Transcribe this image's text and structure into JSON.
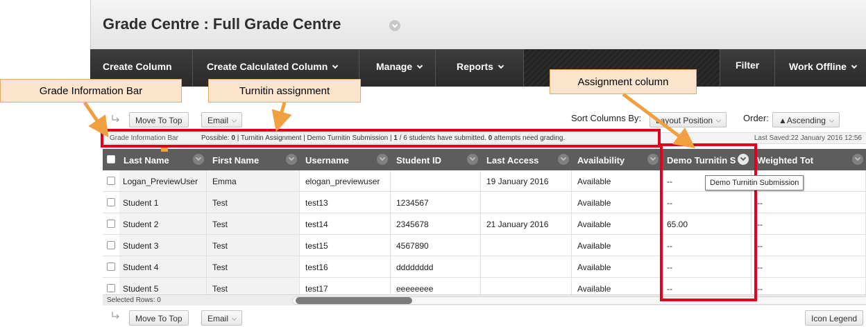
{
  "header": {
    "title": "Grade Centre : Full Grade Centre"
  },
  "toolbar": {
    "create_column": "Create Column",
    "create_calculated": "Create Calculated Column",
    "manage": "Manage",
    "reports": "Reports",
    "filter": "Filter",
    "work_offline": "Work Offline"
  },
  "callouts": {
    "grade_info_bar": "Grade Information Bar",
    "turnitin_assignment": "Turnitin assignment",
    "assignment_column": "Assignment column"
  },
  "actions": {
    "move_to_top": "Move To Top",
    "email": "Email",
    "sort_label": "Sort Columns By:",
    "sort_value": "Layout Position",
    "order_label": "Order:",
    "order_value": "▲Ascending",
    "icon_legend": "Icon Legend"
  },
  "info_bar": {
    "label": "Grade Information Bar",
    "possible_label": "Possible:",
    "possible_value": "0",
    "sep1": " | Turnitin Assignment | Demo Turnitin Submission | ",
    "submitted": "1",
    "of_students": " / 6 students have submitted. ",
    "attempts": "0",
    "attempts_text": " attempts need grading.",
    "saved": "Last Saved:22 January 2016 12:56"
  },
  "grid": {
    "columns": [
      "Last Name",
      "First Name",
      "Username",
      "Student ID",
      "Last Access",
      "Availability",
      "Demo Turnitin S",
      "Weighted Tot"
    ],
    "rows": [
      {
        "last": "Logan_PreviewUser",
        "first": "Emma",
        "user": "elogan_previewuser",
        "id": "",
        "access": "19 January 2016",
        "avail": "Available",
        "demo": "--",
        "weighted": ""
      },
      {
        "last": "Student 1",
        "first": "Test",
        "user": "test13",
        "id": "1234567",
        "access": "",
        "avail": "Available",
        "demo": "--",
        "weighted": "--"
      },
      {
        "last": "Student 2",
        "first": "Test",
        "user": "test14",
        "id": "2345678",
        "access": "21 January 2016",
        "avail": "Available",
        "demo": "65.00",
        "weighted": "--"
      },
      {
        "last": "Student 3",
        "first": "Test",
        "user": "test15",
        "id": "4567890",
        "access": "",
        "avail": "Available",
        "demo": "--",
        "weighted": "--"
      },
      {
        "last": "Student 4",
        "first": "Test",
        "user": "test16",
        "id": "dddddddd",
        "access": "",
        "avail": "Available",
        "demo": "--",
        "weighted": "--"
      },
      {
        "last": "Student 5",
        "first": "Test",
        "user": "test17",
        "id": "eeeeeeee",
        "access": "",
        "avail": "Available",
        "demo": "--",
        "weighted": "--"
      }
    ],
    "selected_rows": "Selected Rows: 0",
    "tooltip": "Demo Turnitin Submission"
  },
  "colors": {
    "toolbar": "#2f2f2f",
    "grid_header": "#5d5d5d",
    "highlight": "#e2001a",
    "callout_bg": "#fce5cc",
    "arrow": "#f0a040"
  }
}
